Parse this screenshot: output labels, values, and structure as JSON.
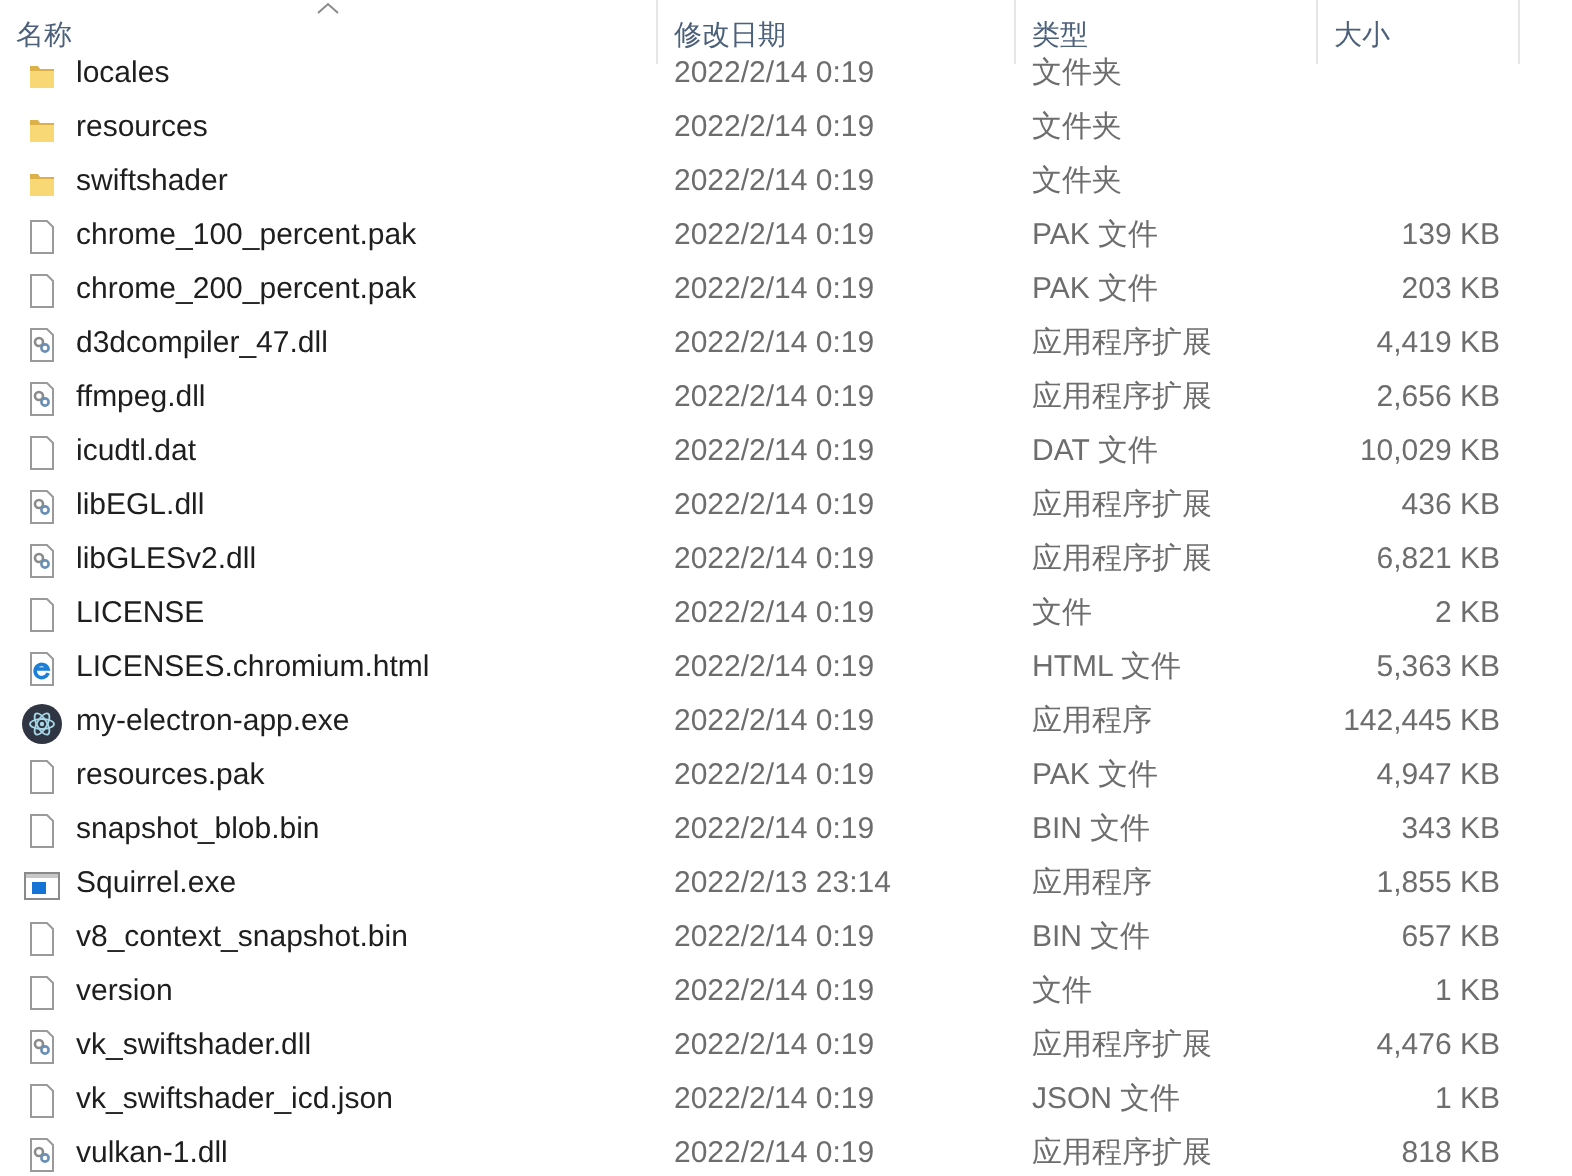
{
  "table": {
    "columns": [
      {
        "label": "名称",
        "sorted": true
      },
      {
        "label": "修改日期",
        "sorted": false
      },
      {
        "label": "类型",
        "sorted": false
      },
      {
        "label": "大小",
        "sorted": false
      }
    ],
    "rows": [
      {
        "kind": "folder",
        "name": "locales",
        "date": "2022/2/14 0:19",
        "type": "文件夹"
      },
      {
        "kind": "folder",
        "name": "resources",
        "date": "2022/2/14 0:19",
        "type": "文件夹"
      },
      {
        "kind": "folder",
        "name": "swiftshader",
        "date": "2022/2/14 0:19",
        "type": "文件夹"
      },
      {
        "kind": "file",
        "name": "chrome_100_percent.pak",
        "date": "2022/2/14 0:19",
        "type": "PAK 文件",
        "size": "139 KB"
      },
      {
        "kind": "file",
        "name": "chrome_200_percent.pak",
        "date": "2022/2/14 0:19",
        "type": "PAK 文件",
        "size": "203 KB"
      },
      {
        "kind": "dll",
        "name": "d3dcompiler_47.dll",
        "date": "2022/2/14 0:19",
        "type": "应用程序扩展",
        "size": "4,419 KB"
      },
      {
        "kind": "dll",
        "name": "ffmpeg.dll",
        "date": "2022/2/14 0:19",
        "type": "应用程序扩展",
        "size": "2,656 KB"
      },
      {
        "kind": "file",
        "name": "icudtl.dat",
        "date": "2022/2/14 0:19",
        "type": "DAT 文件",
        "size": "10,029 KB"
      },
      {
        "kind": "dll",
        "name": "libEGL.dll",
        "date": "2022/2/14 0:19",
        "type": "应用程序扩展",
        "size": "436 KB"
      },
      {
        "kind": "dll",
        "name": "libGLESv2.dll",
        "date": "2022/2/14 0:19",
        "type": "应用程序扩展",
        "size": "6,821 KB"
      },
      {
        "kind": "file",
        "name": "LICENSE",
        "date": "2022/2/14 0:19",
        "type": "文件",
        "size": "2 KB"
      },
      {
        "kind": "html",
        "name": "LICENSES.chromium.html",
        "date": "2022/2/14 0:19",
        "type": "HTML 文件",
        "size": "5,363 KB"
      },
      {
        "kind": "electron",
        "name": "my-electron-app.exe",
        "date": "2022/2/14 0:19",
        "type": "应用程序",
        "size": "142,445 KB"
      },
      {
        "kind": "file",
        "name": "resources.pak",
        "date": "2022/2/14 0:19",
        "type": "PAK 文件",
        "size": "4,947 KB"
      },
      {
        "kind": "file",
        "name": "snapshot_blob.bin",
        "date": "2022/2/14 0:19",
        "type": "BIN 文件",
        "size": "343 KB"
      },
      {
        "kind": "exe",
        "name": "Squirrel.exe",
        "date": "2022/2/13 23:14",
        "type": "应用程序",
        "size": "1,855 KB"
      },
      {
        "kind": "file",
        "name": "v8_context_snapshot.bin",
        "date": "2022/2/14 0:19",
        "type": "BIN 文件",
        "size": "657 KB"
      },
      {
        "kind": "file",
        "name": "version",
        "date": "2022/2/14 0:19",
        "type": "文件",
        "size": "1 KB"
      },
      {
        "kind": "dll",
        "name": "vk_swiftshader.dll",
        "date": "2022/2/14 0:19",
        "type": "应用程序扩展",
        "size": "4,476 KB"
      },
      {
        "kind": "file",
        "name": "vk_swiftshader_icd.json",
        "date": "2022/2/14 0:19",
        "type": "JSON 文件",
        "size": "1 KB"
      },
      {
        "kind": "dll",
        "name": "vulkan-1.dll",
        "date": "2022/2/14 0:19",
        "type": "应用程序扩展",
        "size": "818 KB"
      }
    ]
  }
}
